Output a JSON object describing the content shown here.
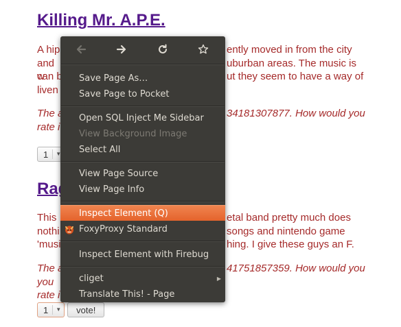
{
  "page": {
    "sections": [
      {
        "title": "Killing Mr. A.P.E.",
        "lines": [
          "A hip",
          "ently moved in from the city",
          "and w",
          "uburban areas. The music is",
          "can b",
          "ut they seem to have a way of",
          "liven"
        ],
        "rate_lines": [
          "The a",
          "34181307877. How would you",
          "rate i"
        ],
        "rating_value": "1"
      },
      {
        "title": "Rag",
        "lines": [
          "This",
          "etal band pretty much does",
          "nothi",
          "songs and nintendo game",
          "'musi",
          "hing. I give these guys an F."
        ],
        "rate_lines": [
          "The a",
          "41751857359. How would you",
          "you rate i"
        ],
        "rating_value": "1",
        "vote_label": "vote!"
      }
    ]
  },
  "context_menu": {
    "nav": [
      {
        "icon": "back-arrow-icon",
        "glyph": "🡐",
        "enabled": false
      },
      {
        "icon": "forward-arrow-icon",
        "glyph": "🡒",
        "enabled": true
      },
      {
        "icon": "reload-icon",
        "glyph": "↻",
        "enabled": true
      },
      {
        "icon": "bookmark-star-icon",
        "glyph": "☆",
        "enabled": true
      }
    ],
    "save_page_as": "Save Page As…",
    "save_to_pocket": "Save Page to Pocket",
    "open_sql_inject": "Open SQL Inject Me Sidebar",
    "view_background_image": "View Background Image",
    "select_all": "Select All",
    "view_page_source": "View Page Source",
    "view_page_info": "View Page Info",
    "inspect_element": "Inspect Element (Q)",
    "foxyproxy": "FoxyProxy Standard",
    "inspect_firebug": "Inspect Element with Firebug",
    "cliget": "cliget",
    "translate": "Translate This! - Page"
  },
  "colors": {
    "link": "#551a8b",
    "text": "#a52a2a",
    "menu_bg": "#3c3b37",
    "highlight": "#e9682f"
  }
}
